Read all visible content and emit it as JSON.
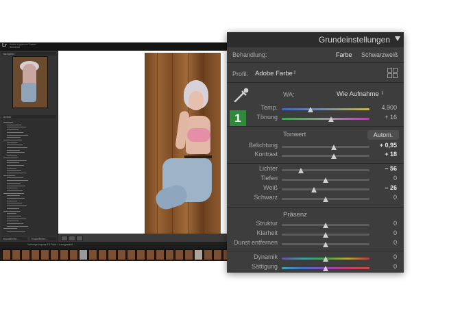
{
  "app": {
    "logo": "Lr",
    "catalog_line1": "Adobe Lightroom Classic",
    "catalog_line2": "Bibliothek"
  },
  "left_panel": {
    "navigator_title": "Navigator",
    "folders_title": "Ordner",
    "import_label": "Importieren...",
    "export_label": "Exportieren..."
  },
  "filmstrip_bar": {
    "path": "Vorherige Importe 15 Fotos / 1 ausgewählt"
  },
  "basic_panel": {
    "title": "Grundeinstellungen",
    "treatment": {
      "label": "Behandlung:",
      "color": "Farbe",
      "bw": "Schwarzweiß"
    },
    "profile": {
      "label": "Profil:",
      "value": "Adobe Farbe"
    },
    "wb": {
      "label": "WA:",
      "value": "Wie Aufnahme"
    },
    "badge": "1",
    "tone_title": "Tonwert",
    "auto_label": "Autom.",
    "presence_title": "Präsenz",
    "sliders": [
      {
        "label": "Temp.",
        "value": "4.900",
        "level": 0.33,
        "track": "temp",
        "bright": false
      },
      {
        "label": "Tönung",
        "value": "+ 16",
        "level": 0.56,
        "track": "tint",
        "bright": false
      },
      {
        "label": "Belichtung",
        "value": "+ 0,95",
        "level": 0.59,
        "track": "plain",
        "bright": true
      },
      {
        "label": "Kontrast",
        "value": "+ 18",
        "level": 0.59,
        "track": "plain",
        "bright": true
      },
      {
        "label": "Lichter",
        "value": "– 56",
        "level": 0.22,
        "track": "plain",
        "bright": true
      },
      {
        "label": "Tiefen",
        "value": "0",
        "level": 0.5,
        "track": "plain",
        "bright": false
      },
      {
        "label": "Weiß",
        "value": "– 26",
        "level": 0.37,
        "track": "plain",
        "bright": true
      },
      {
        "label": "Schwarz",
        "value": "0",
        "level": 0.5,
        "track": "plain",
        "bright": false
      },
      {
        "label": "Struktur",
        "value": "0",
        "level": 0.5,
        "track": "plain",
        "bright": false
      },
      {
        "label": "Klarheit",
        "value": "0",
        "level": 0.5,
        "track": "plain",
        "bright": false
      },
      {
        "label": "Dunst entfernen",
        "value": "0",
        "level": 0.5,
        "track": "plain",
        "bright": false
      },
      {
        "label": "Dynamik",
        "value": "0",
        "level": 0.5,
        "track": "vib",
        "bright": false
      },
      {
        "label": "Sättigung",
        "value": "0",
        "level": 0.5,
        "track": "sat",
        "bright": false
      }
    ]
  }
}
